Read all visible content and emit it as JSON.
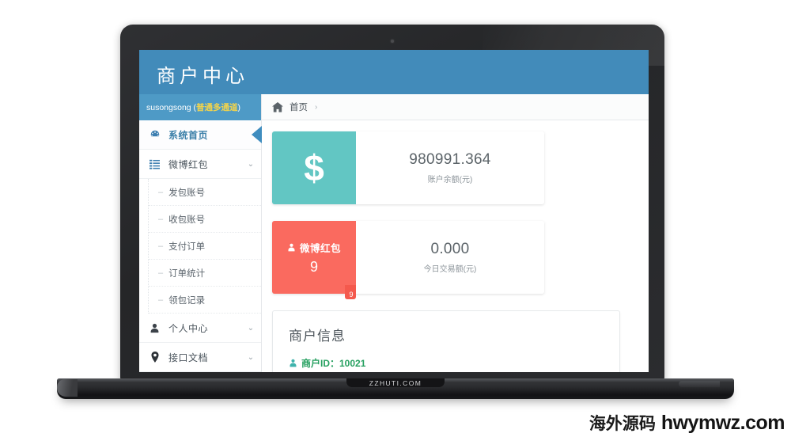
{
  "device": {
    "base_brand": "ZZHUTI.COM"
  },
  "app": {
    "brand_title": "商户中心",
    "sidebar": {
      "user_name": "susongsong (",
      "user_tag": "普通多通道",
      "user_name_close": ")",
      "items": [
        {
          "label": "系统首页",
          "icon": "dashboard-icon",
          "active": true,
          "caret": ""
        },
        {
          "label": "微博红包",
          "icon": "list-icon",
          "active": false,
          "caret": "⌄"
        },
        {
          "label": "个人中心",
          "icon": "user-icon",
          "active": false,
          "caret": "⌄"
        },
        {
          "label": "接口文档",
          "icon": "map-pin-icon",
          "active": false,
          "caret": "⌄"
        }
      ],
      "subitems": [
        {
          "label": "发包账号"
        },
        {
          "label": "收包账号"
        },
        {
          "label": "支付订单"
        },
        {
          "label": "订单统计"
        },
        {
          "label": "领包记录"
        }
      ]
    },
    "breadcrumb": {
      "home_label": "首页",
      "separator": "›"
    },
    "cards": [
      {
        "icon_glyph": "$",
        "icon_color": "#62c6c3",
        "value": "980991.364",
        "label": "账户余额(元)"
      },
      {
        "left_title": "微博红包",
        "left_count": "9",
        "icon_color": "#fa6a5f",
        "badge": "9",
        "value": "0.000",
        "label": "今日交易额(元)"
      }
    ],
    "info_card": {
      "title": "商户信息",
      "merchant_id_label": "商户ID：10021"
    }
  },
  "watermark": {
    "cn": "海外源码",
    "en": "hwymwz.com"
  },
  "colors": {
    "header_blue": "#428bba",
    "user_bar_blue": "#4e9ac6",
    "teal": "#62c6c3",
    "coral": "#fa6a5f",
    "green_text": "#26a060"
  }
}
